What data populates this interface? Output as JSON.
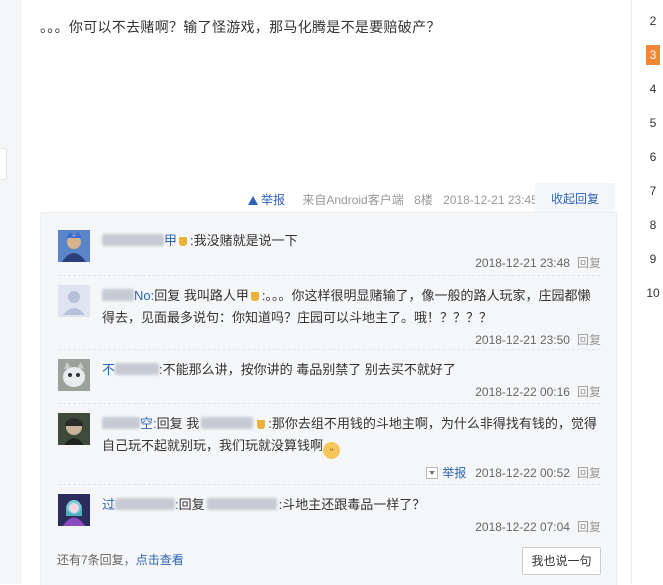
{
  "main_post": {
    "text": "。。。你可以不去赌啊？输了怪游戏，那马化腾是不是要赔破产？",
    "report_label": "举报",
    "source": "来自Android客户端",
    "floor": "8楼",
    "time": "2018-12-21 23:45",
    "collapse_label": "收起回复"
  },
  "replies": [
    {
      "prefix": "",
      "name_tail": "甲",
      "text": ":我没赌就是说一下",
      "date": "2018-12-21 23:48",
      "reply_label": "回复"
    },
    {
      "prefix": "",
      "name_tail": "No:",
      "text": "回复 我叫路人甲",
      "text2": ":。。。你这样很明显赌输了，像一般的路人玩家，庄园都懒得去，见面最多说句：你知道吗？庄园可以斗地主了。哦！？？？？",
      "date": "2018-12-21 23:50",
      "reply_label": "回复"
    },
    {
      "prefix": "不",
      "name_tail": "",
      "text": ":不能那么讲，按你讲的 毒品别禁了 别去买不就好了",
      "date": "2018-12-22 00:16",
      "reply_label": "回复"
    },
    {
      "prefix": "",
      "name_tail": "空:",
      "text": "回复 我",
      "text2": ":那你去组不用钱的斗地主啊，为什么非得找有钱的，觉得自己玩不起就别玩，我们玩就没算钱啊",
      "date": "2018-12-22 00:52",
      "report_label": "举报",
      "reply_label": "回复"
    },
    {
      "prefix": "过",
      "name_tail": ":",
      "text": "回复",
      "text2": ":斗地主还跟毒品一样了？",
      "date": "2018-12-22 07:04",
      "reply_label": "回复"
    }
  ],
  "more": {
    "text": "还有7条回复，",
    "link": "点击查看"
  },
  "say_button": "我也说一句",
  "pager": [
    "2",
    "3",
    "4",
    "5",
    "6",
    "7",
    "8",
    "9",
    "10"
  ],
  "pager_active": "3",
  "colors": {
    "link": "#2d64b3",
    "pager_active": "#f0873a",
    "reply_bg": "#f5f6f8"
  }
}
